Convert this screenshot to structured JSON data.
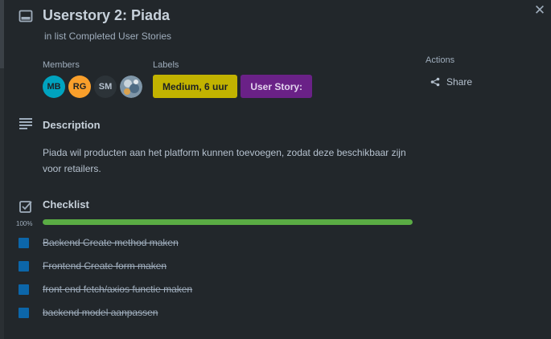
{
  "card": {
    "title": "Userstory 2: Piada",
    "subtitle": "in list Completed User Stories",
    "close_icon": "close-icon"
  },
  "members": {
    "label": "Members",
    "items": [
      {
        "initials": "MB",
        "color": "#00a3bf"
      },
      {
        "initials": "RG",
        "color": "#f99f2b"
      },
      {
        "initials": "SM",
        "color": "#2c3338"
      },
      {
        "initials": "",
        "color": "#6a8aa6"
      }
    ]
  },
  "labels": {
    "label": "Labels",
    "items": [
      {
        "text": "Medium, 6 uur",
        "color": "#c2b300"
      },
      {
        "text": "User Story:",
        "color": "#6a2187"
      }
    ]
  },
  "actions": {
    "label": "Actions",
    "share_label": "Share"
  },
  "description": {
    "heading": "Description",
    "text": "Piada wil producten aan het platform kunnen toevoegen, zodat deze beschikbaar zijn voor retailers."
  },
  "checklist": {
    "heading": "Checklist",
    "progress_label": "100%",
    "progress": 1.0,
    "items": [
      {
        "text": "Backend Create method maken",
        "done": true
      },
      {
        "text": "Frontend Create form maken",
        "done": true
      },
      {
        "text": "front end fetch/axios functie maken",
        "done": true
      },
      {
        "text": "backend model aanpassen",
        "done": true
      }
    ]
  }
}
